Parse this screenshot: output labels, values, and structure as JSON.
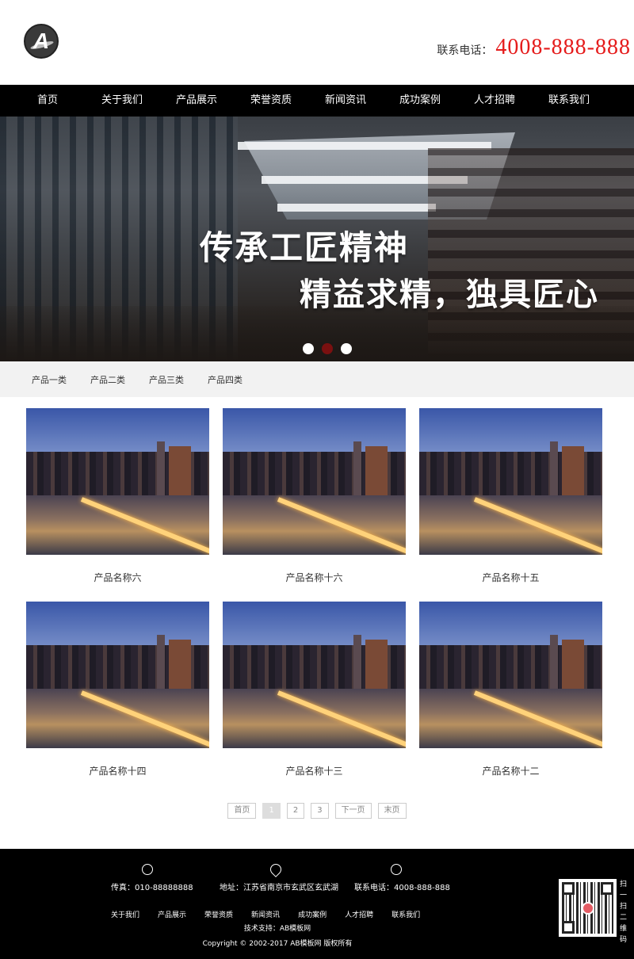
{
  "header": {
    "logo_letter": "A",
    "phone_label": "联系电话：",
    "phone_number": "4008-888-888"
  },
  "nav": {
    "items": [
      "首页",
      "关于我们",
      "产品展示",
      "荣誉资质",
      "新闻资讯",
      "成功案例",
      "人才招聘",
      "联系我们"
    ]
  },
  "banner": {
    "line1": "传承工匠精神",
    "line2": "精益求精，独具匠心",
    "slide_count": 3,
    "active_slide": 2
  },
  "categories": [
    "产品一类",
    "产品二类",
    "产品三类",
    "产品四类"
  ],
  "products": [
    {
      "name": "产品名称六"
    },
    {
      "name": "产品名称十六"
    },
    {
      "name": "产品名称十五"
    },
    {
      "name": "产品名称十四"
    },
    {
      "name": "产品名称十三"
    },
    {
      "name": "产品名称十二"
    }
  ],
  "pagination": {
    "first": "首页",
    "pages": [
      "1",
      "2",
      "3"
    ],
    "current": "1",
    "next": "下一页",
    "last": "末页"
  },
  "footer": {
    "fax": "传真：010-88888888",
    "address": "地址：江苏省南京市玄武区玄武湖",
    "phone": "联系电话：4008-888-888",
    "links": [
      "关于我们",
      "产品展示",
      "荣誉资质",
      "新闻资讯",
      "成功案例",
      "人才招聘",
      "联系我们"
    ],
    "tech": "技术支持：AB模板网",
    "copyright": "Copyright © 2002-2017 AB模板网 版权所有",
    "qr_label": "扫一扫二维码"
  },
  "colors": {
    "phone": "#e51c1c",
    "nav_bg": "#000000",
    "active_dot": "#7a1010"
  }
}
